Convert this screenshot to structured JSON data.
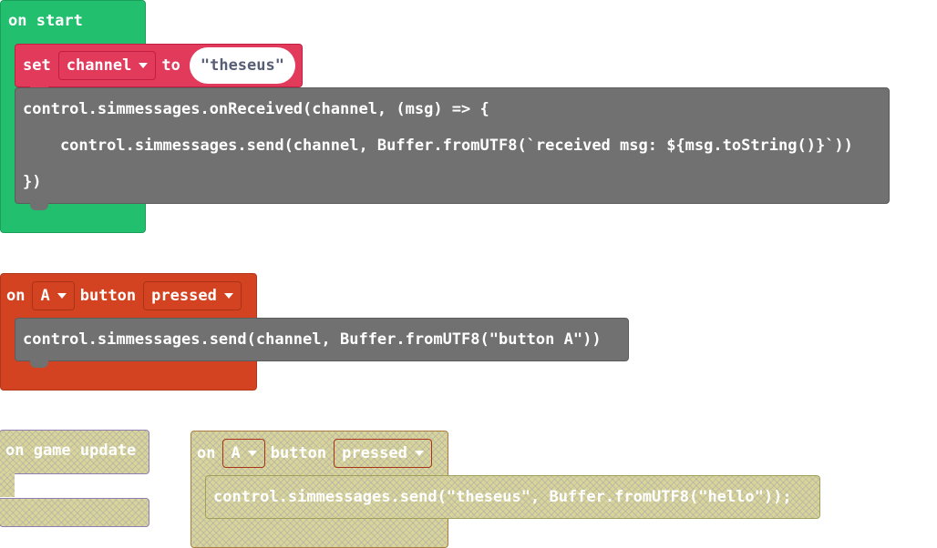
{
  "on_start": {
    "hat_label": "on start",
    "set_block": {
      "set_label": "set",
      "variable": "channel",
      "to_label": "to",
      "value": "\"theseus\""
    },
    "code_lines": [
      "control.simmessages.onReceived(channel, (msg) => {",
      "    control.simmessages.send(channel, Buffer.fromUTF8(`received msg: ${msg.toString()}`))",
      "})"
    ]
  },
  "on_button_pressed": {
    "on_label": "on",
    "button_value": "A",
    "button_label": "button",
    "event_value": "pressed",
    "code_line": "control.simmessages.send(channel, Buffer.fromUTF8(\"button A\"))"
  },
  "on_game_update": {
    "hat_label": "on game update"
  },
  "on_button_pressed_disabled": {
    "on_label": "on",
    "button_value": "A",
    "button_label": "button",
    "event_value": "pressed",
    "code_line": "control.simmessages.send(\"theseus\", Buffer.fromUTF8(\"hello\"));"
  },
  "colors": {
    "loops_green": "#22bf6e",
    "variables_red": "#e23a5b",
    "controller_orange": "#d34321",
    "code_gray": "#717171",
    "disabled_fill": "#d8d49a"
  }
}
